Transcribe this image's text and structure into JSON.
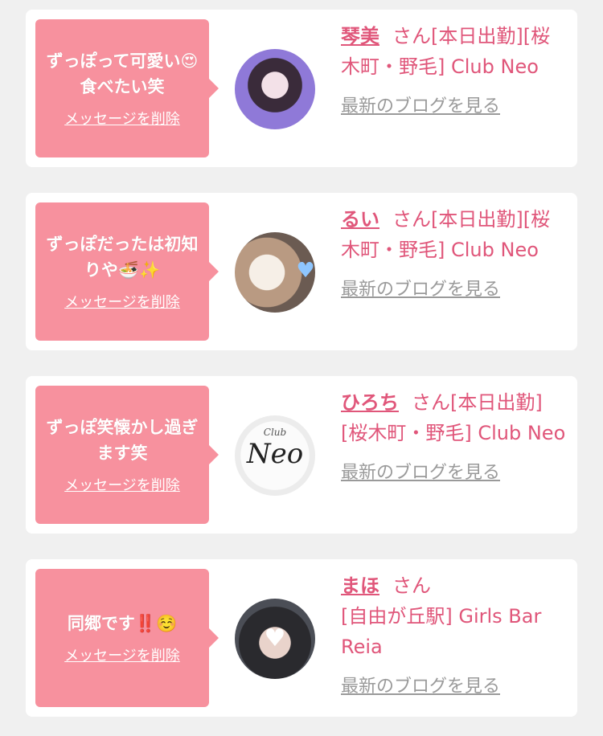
{
  "cards": [
    {
      "message": "ずっぽって可愛い😍食べたい笑",
      "delete_label": "メッセージを削除",
      "name": "琴美",
      "honorific": "さん",
      "shop": "[本日出勤][桜木町・野毛] Club Neo",
      "blog_link": "最新のブログを見る"
    },
    {
      "message": "ずっぽだったは初知りや🍜✨",
      "delete_label": "メッセージを削除",
      "name": "るい",
      "honorific": "さん",
      "shop": "[本日出勤][桜木町・野毛] Club Neo",
      "blog_link": "最新のブログを見る"
    },
    {
      "message": "ずっぽ笑懐かし過ぎます笑",
      "delete_label": "メッセージを削除",
      "name": "ひろち",
      "honorific": "さん",
      "shop": "[本日出勤][桜木町・野毛] Club Neo",
      "blog_link": "最新のブログを見る",
      "avatar_club": "Club",
      "avatar_logo": "Neo"
    },
    {
      "message": "同郷です‼️☺️",
      "delete_label": "メッセージを削除",
      "name": "まほ",
      "honorific": "さん",
      "shop": "[自由が丘駅] Girls Bar Reia",
      "blog_link": "最新のブログを見る"
    }
  ],
  "colors": {
    "bubble": "#f7919e",
    "accent": "#e0567a",
    "link_gray": "#9a9a9a",
    "page_bg": "#f0f0f0"
  }
}
